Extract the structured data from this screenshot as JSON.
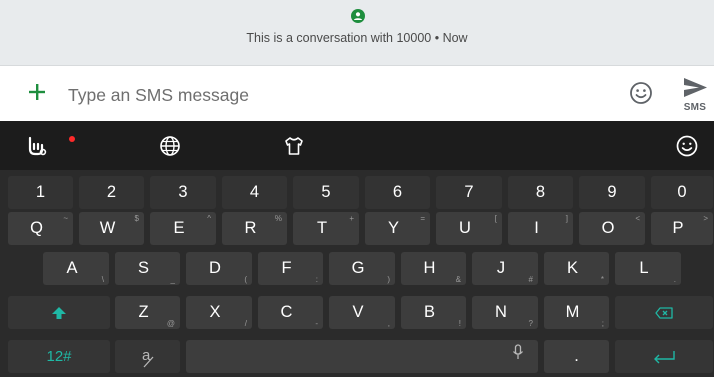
{
  "conversation": {
    "info_text": "This is a conversation with 10000 • Now"
  },
  "compose": {
    "placeholder": "Type an SMS message",
    "send_label": "SMS"
  },
  "keyboard": {
    "number_row": [
      "1",
      "2",
      "3",
      "4",
      "5",
      "6",
      "7",
      "8",
      "9",
      "0"
    ],
    "row1": [
      {
        "key": "Q",
        "sub": "~"
      },
      {
        "key": "W",
        "sub": "$"
      },
      {
        "key": "E",
        "sub": "^"
      },
      {
        "key": "R",
        "sub": "%"
      },
      {
        "key": "T",
        "sub": "+"
      },
      {
        "key": "Y",
        "sub": "="
      },
      {
        "key": "U",
        "sub": "["
      },
      {
        "key": "I",
        "sub": "]"
      },
      {
        "key": "O",
        "sub": "<"
      },
      {
        "key": "P",
        "sub": ">"
      }
    ],
    "row2": [
      {
        "key": "A",
        "sub": "\\"
      },
      {
        "key": "S",
        "sub": "_"
      },
      {
        "key": "D",
        "sub": "("
      },
      {
        "key": "F",
        "sub": ":"
      },
      {
        "key": "G",
        "sub": ")"
      },
      {
        "key": "H",
        "sub": "&"
      },
      {
        "key": "J",
        "sub": "#"
      },
      {
        "key": "K",
        "sub": "*"
      },
      {
        "key": "L",
        "sub": "."
      }
    ],
    "row3": [
      {
        "key": "Z",
        "sub": "@"
      },
      {
        "key": "X",
        "sub": "/"
      },
      {
        "key": "C",
        "sub": "-"
      },
      {
        "key": "V",
        "sub": ","
      },
      {
        "key": "B",
        "sub": "!"
      },
      {
        "key": "N",
        "sub": "?"
      },
      {
        "key": "M",
        "sub": ";"
      }
    ],
    "bottom": {
      "symbols_label": "12#",
      "period": "."
    }
  }
}
